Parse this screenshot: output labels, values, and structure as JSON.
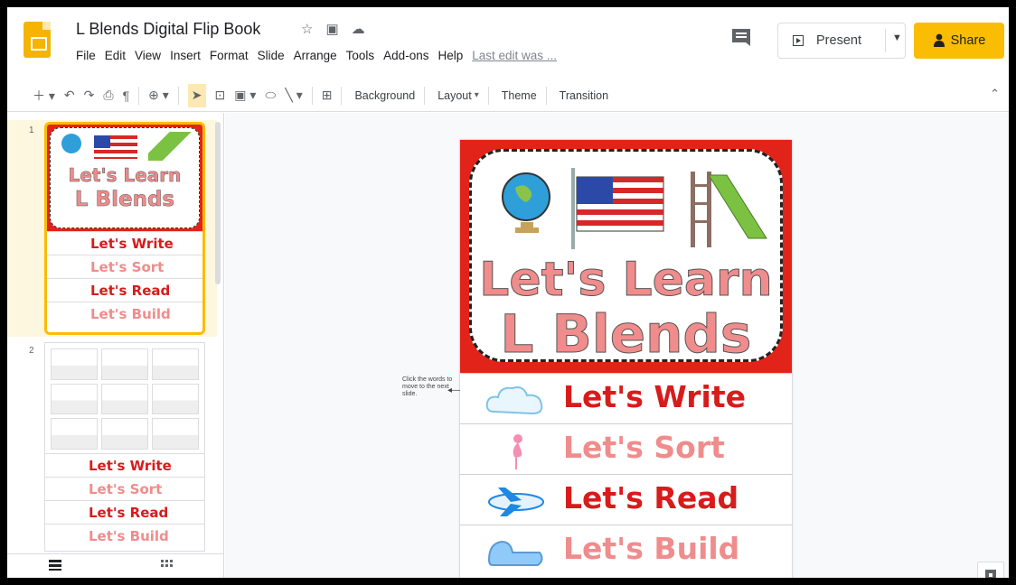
{
  "app": {
    "title": "L Blends Digital Flip Book"
  },
  "menu": [
    "File",
    "Edit",
    "View",
    "Insert",
    "Format",
    "Slide",
    "Arrange",
    "Tools",
    "Add-ons",
    "Help"
  ],
  "last_edit": "Last edit was ...",
  "present_label": "Present",
  "share_label": "Share",
  "toolbar": {
    "background": "Background",
    "layout": "Layout",
    "theme": "Theme",
    "transition": "Transition"
  },
  "filmstrip": {
    "slide1_number": "1",
    "slide2_number": "2"
  },
  "slide": {
    "title_line1": "Let's Learn",
    "title_line2": "L Blends",
    "rows": [
      "Let's Write",
      "Let's Sort",
      "Let's Read",
      "Let's Build"
    ],
    "hint": "Click the words to move to the next slide."
  },
  "colors": {
    "accent": "#fbbc04",
    "red": "#e2231a",
    "pink": "#f08c8c"
  },
  "icons": [
    "slides-logo-icon",
    "star-icon",
    "folder-icon",
    "cloud-icon",
    "comment-icon",
    "present-icon",
    "share-person-icon"
  ]
}
